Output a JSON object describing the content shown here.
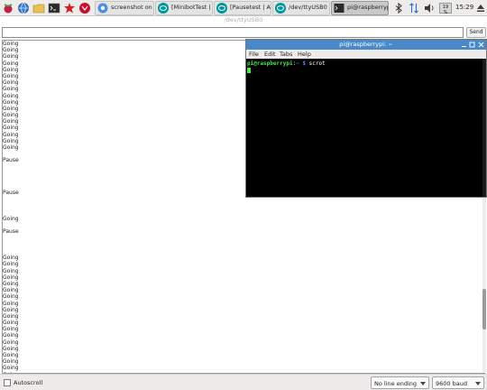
{
  "taskbar": {
    "launcher_icons": [
      "raspberry-menu-icon",
      "browser-globe-icon",
      "file-manager-icon",
      "terminal-icon",
      "mathematica-icon",
      "wolfram-icon"
    ],
    "tasks": [
      {
        "label": "screenshot on ...",
        "icon": "chromium-icon"
      },
      {
        "label": "[MinibotTest | ...",
        "icon": "arduino-icon"
      },
      {
        "label": "[Pausetest | Ar...",
        "icon": "arduino-icon"
      },
      {
        "label": "/dev/ttyUSB0",
        "icon": "arduino-icon"
      },
      {
        "label": "pi@raspberryp...",
        "icon": "terminal-icon"
      }
    ],
    "tray": {
      "cpu_label": "19 %",
      "clock": "15:29"
    }
  },
  "serial_monitor": {
    "title": "/dev/ttyUSB0",
    "input_value": "",
    "send_label": "Send",
    "output_lines": [
      "Going",
      "Going",
      "Going",
      "Going",
      "Going",
      "Going",
      "Going",
      "Going",
      "Going",
      "Going",
      "Going",
      "Going",
      "Going",
      "Going",
      "Going",
      "Going",
      "Going",
      "",
      "Pause",
      "",
      "",
      "",
      "",
      "Pause",
      "",
      "",
      "",
      "Going",
      "",
      "Pause",
      "",
      "",
      "",
      "Going",
      "Going",
      "Going",
      "Going",
      "Going",
      "Going",
      "Going",
      "Going",
      "Going",
      "Going",
      "Going",
      "Going",
      "Going",
      "Going",
      "Going",
      "Going",
      "Going",
      "Going",
      "Going",
      "Going",
      "Going",
      "Going"
    ],
    "autoscroll_label": "Autoscroll",
    "autoscroll_checked": false,
    "line_ending": "No line ending",
    "baud": "9600 baud"
  },
  "terminal": {
    "title": "pi@raspberrypi: ~",
    "menu": [
      "File",
      "Edit",
      "Tabs",
      "Help"
    ],
    "prompt_user": "pi@raspberrypi",
    "prompt_sep": ":",
    "prompt_path": "~ $",
    "command": " scrot"
  }
}
